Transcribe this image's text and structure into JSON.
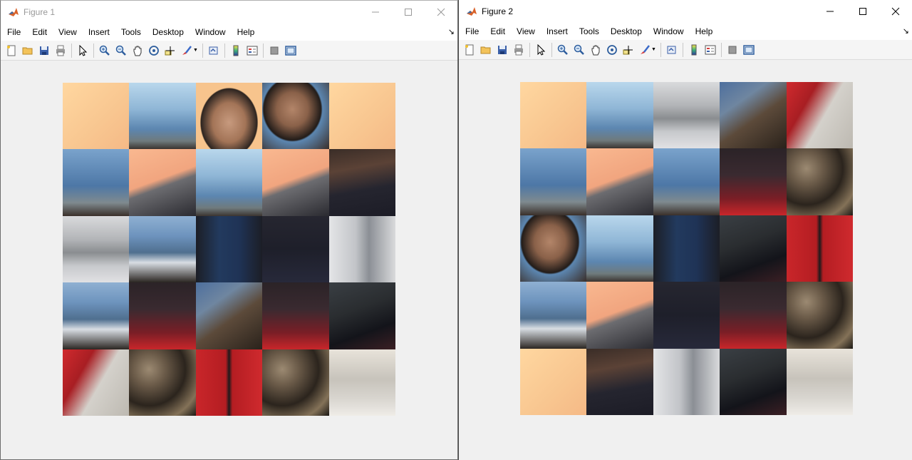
{
  "windows": [
    {
      "title": "Figure 1",
      "menu": [
        "File",
        "Edit",
        "View",
        "Insert",
        "Tools",
        "Desktop",
        "Window",
        "Help"
      ],
      "controls": [
        "minimize",
        "maximize",
        "close"
      ],
      "puzzle": {
        "grid": "5x5",
        "tiles": [
          "p-peach",
          "p-sea",
          "p-face",
          "p-face2",
          "p-peach",
          "p-sea2",
          "p-skin",
          "p-sea",
          "p-skin",
          "p-beard",
          "p-blur",
          "p-water",
          "p-shirt",
          "p-jacket",
          "p-blur2",
          "p-water",
          "p-red2",
          "p-rock2",
          "p-red2",
          "p-knee",
          "p-arm",
          "p-rock",
          "p-red",
          "p-rock",
          "p-sand"
        ]
      }
    },
    {
      "title": "Figure 2",
      "menu": [
        "File",
        "Edit",
        "View",
        "Insert",
        "Tools",
        "Desktop",
        "Window",
        "Help"
      ],
      "controls": [
        "minimize",
        "maximize",
        "close"
      ],
      "puzzle": {
        "grid": "5x5",
        "tiles": [
          "p-peach",
          "p-sea",
          "p-blur",
          "p-rock2",
          "p-arm",
          "p-sea2",
          "p-skin",
          "p-sea2",
          "p-red2",
          "p-rock",
          "p-face2",
          "p-sea",
          "p-shirt",
          "p-knee",
          "p-red",
          "p-water",
          "p-skin",
          "p-jacket",
          "p-red2",
          "p-rock",
          "p-peach",
          "p-beard",
          "p-blur2",
          "p-knee",
          "p-sand"
        ]
      }
    }
  ],
  "toolbar_icons": [
    "new-figure-icon",
    "open-file-icon",
    "save-icon",
    "print-icon",
    "|",
    "edit-plot-icon",
    "|",
    "zoom-in-icon",
    "zoom-out-icon",
    "pan-icon",
    "rotate-3d-icon",
    "data-cursor-icon",
    "brush-icon",
    "|",
    "link-plot-icon",
    "|",
    "colorbar-icon",
    "legend-icon",
    "|",
    "hide-plot-tools-icon",
    "show-plot-tools-icon"
  ],
  "colors": {
    "title_inactive": "#999999",
    "title_active": "#000000",
    "canvas_bg": "#f0f0f0"
  }
}
